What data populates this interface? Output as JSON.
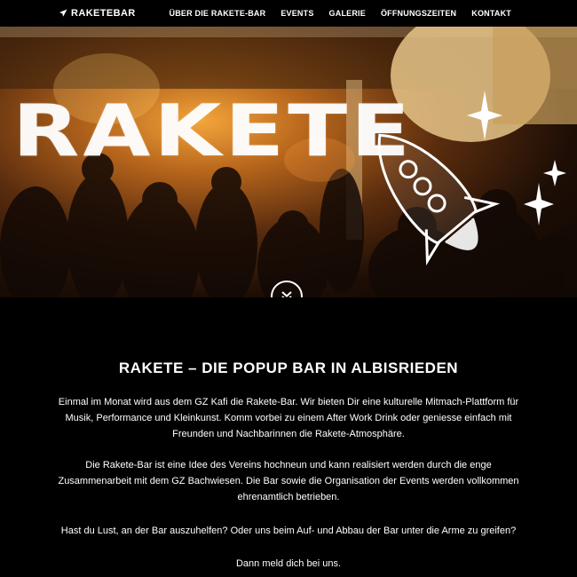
{
  "nav": {
    "brand": "RAKETEBAR",
    "brand_icon": "rocket-icon",
    "items": [
      {
        "label": "ÜBER DIE RAKETE-BAR"
      },
      {
        "label": "EVENTS"
      },
      {
        "label": "GALERIE"
      },
      {
        "label": "ÖFFNUNGSZEITEN"
      },
      {
        "label": "KONTAKT"
      }
    ]
  },
  "hero": {
    "logo_text": "RAKETE",
    "logo_illustration": "rocket-illustration",
    "scroll_icon": "chevron-double-down-icon"
  },
  "content": {
    "title": "RAKETE – DIE POPUP BAR IN ALBISRIEDEN",
    "paragraphs": [
      "Einmal im Monat wird aus dem GZ Kafi die Rakete-Bar. Wir bieten Dir eine kulturelle Mitmach-Plattform für Musik, Performance und Kleinkunst. Komm vorbei zu einem After Work Drink oder geniesse einfach mit Freunden und Nachbarinnen die Rakete-Atmosphäre.",
      "Die Rakete-Bar ist eine Idee des Vereins hochneun und kann realisiert werden durch die enge Zusammenarbeit mit dem GZ Bachwiesen. Die Bar sowie die Organisation der Events werden vollkommen ehrenamtlich betrieben.",
      "Hast du Lust, an der Bar auszuhelfen? Oder uns beim Auf- und Abbau der Bar unter die Arme zu greifen?",
      "Dann meld dich bei uns."
    ]
  },
  "colors": {
    "background": "#000000",
    "text": "#ffffff",
    "hero_glow": "#f3a53a"
  }
}
